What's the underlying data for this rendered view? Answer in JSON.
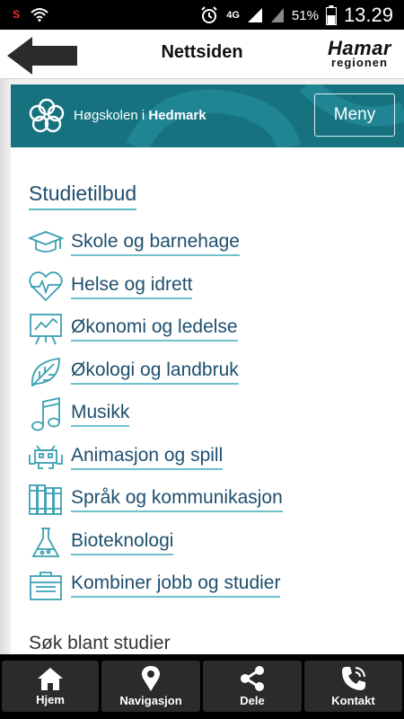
{
  "status_bar": {
    "network": "4G",
    "battery": "51%",
    "time": "13.29"
  },
  "header": {
    "title": "Nettsiden",
    "logo_line1": "Hamar",
    "logo_line2": "regionen"
  },
  "site": {
    "school_prefix": "Høgskolen i ",
    "school_name": "Hedmark",
    "menu_label": "Meny",
    "section_title": "Studietilbud",
    "items": [
      {
        "label": "Skole og barnehage",
        "icon": "graduation-cap-icon"
      },
      {
        "label": "Helse og idrett",
        "icon": "heart-pulse-icon"
      },
      {
        "label": "Økonomi og ledelse",
        "icon": "chart-board-icon"
      },
      {
        "label": "Økologi og landbruk",
        "icon": "leaf-icon"
      },
      {
        "label": "Musikk",
        "icon": "music-note-icon"
      },
      {
        "label": "Animasjon og spill",
        "icon": "space-invader-icon"
      },
      {
        "label": "Språk og kommunikasjon",
        "icon": "books-icon"
      },
      {
        "label": "Bioteknologi",
        "icon": "flask-icon"
      },
      {
        "label": "Kombiner jobb og studier",
        "icon": "briefcase-icon"
      }
    ],
    "search_hint": "Søk blant studier"
  },
  "bottom_nav": [
    {
      "label": "Hjem",
      "icon": "home-icon"
    },
    {
      "label": "Navigasjon",
      "icon": "map-pin-icon"
    },
    {
      "label": "Dele",
      "icon": "share-icon"
    },
    {
      "label": "Kontakt",
      "icon": "phone-icon"
    }
  ],
  "colors": {
    "banner": "#16727f",
    "link": "#1e4f6e",
    "underline": "#6ec0cb",
    "icon": "#3aa0b2"
  }
}
